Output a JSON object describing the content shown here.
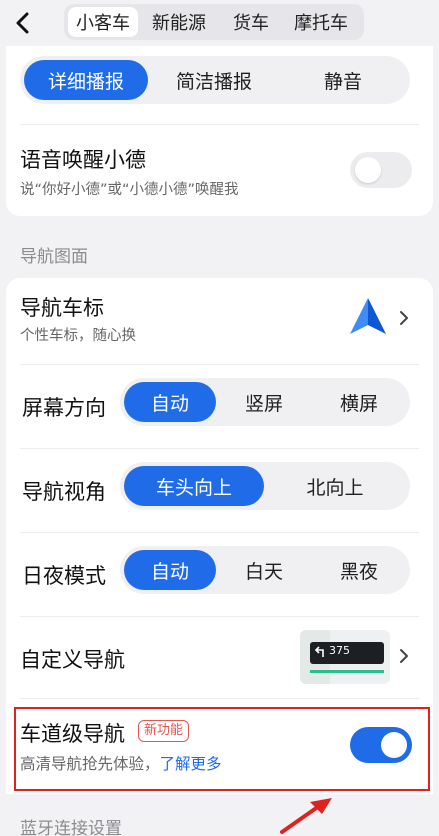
{
  "header": {
    "tabs": [
      "小客车",
      "新能源",
      "货车",
      "摩托车"
    ],
    "active_tab": 0
  },
  "voice": {
    "modes": [
      "详细播报",
      "简洁播报",
      "静音"
    ],
    "wake_title": "语音唤醒小德",
    "wake_sub": "说“你好小德”或“小德小德”唤醒我",
    "wake_enabled": false
  },
  "nav_section": {
    "label": "导航图面",
    "car_icon_title": "导航车标",
    "car_icon_sub": "个性车标，随心换",
    "orientation": {
      "label": "屏幕方向",
      "options": [
        "自动",
        "竖屏",
        "横屏"
      ]
    },
    "view": {
      "label": "导航视角",
      "options": [
        "车头向上",
        "北向上"
      ]
    },
    "daynight": {
      "label": "日夜模式",
      "options": [
        "自动",
        "白天",
        "黑夜"
      ]
    },
    "custom_title": "自定义导航",
    "preview_text": "375",
    "lane_title": "车道级导航",
    "lane_badge": "新功能",
    "lane_sub": "高清导航抢先体验，",
    "lane_link": "了解更多",
    "lane_enabled": true
  },
  "bluetooth_label": "蓝牙连接设置",
  "colors": {
    "accent": "#1f6be8",
    "highlight": "#e0221f",
    "badge": "#e6554f"
  }
}
